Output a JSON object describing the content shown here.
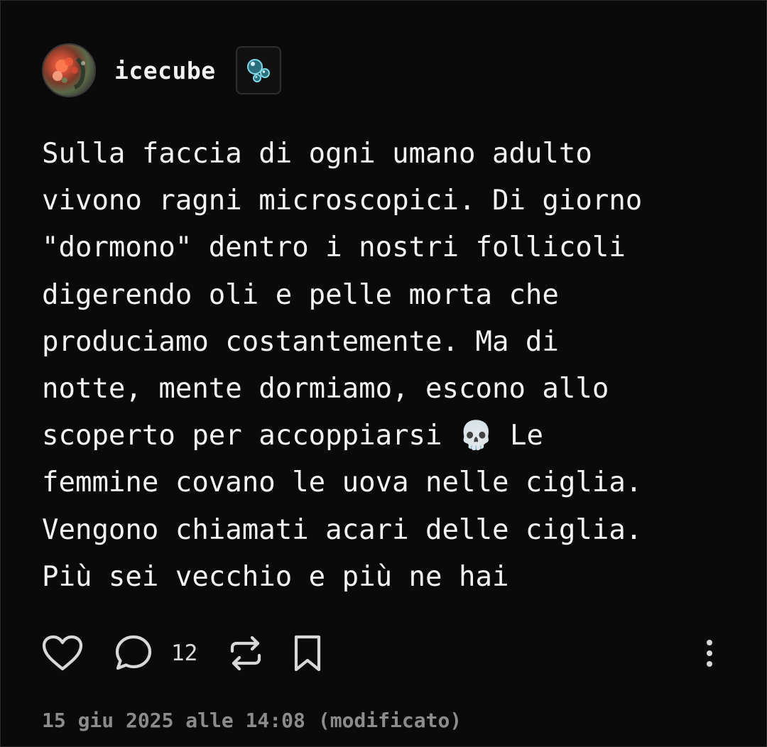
{
  "post": {
    "author": {
      "username": "icecube",
      "badge_icon": "bubbles-icon"
    },
    "text_lines": [
      "Sulla faccia di ogni umano adulto",
      "vivono ragni microscopici. Di giorno",
      "\"dormono\" dentro i nostri follicoli",
      "digerendo oli e pelle morta che",
      "produciamo costantemente. Ma di",
      "notte, mente dormiamo, escono allo",
      "scoperto per accoppiarsi 💀 Le",
      "femmine covano le uova nelle ciglia.",
      "Vengono chiamati acari delle ciglia.",
      "Più sei vecchio e più ne hai"
    ],
    "actions": {
      "like_icon": "heart-icon",
      "comment_icon": "comment-icon",
      "comment_count": "12",
      "repost_icon": "repost-icon",
      "bookmark_icon": "bookmark-icon",
      "more_icon": "more-vertical-icon"
    },
    "timestamp": "15 giu 2025 alle 14:08",
    "edited_label": "(modificato)"
  },
  "colors": {
    "background": "#0a0a0a",
    "text": "#f4f4f4",
    "muted": "#8c8c8c",
    "icon": "#d8d8d8",
    "badge_accent": "#4fb6c8"
  }
}
